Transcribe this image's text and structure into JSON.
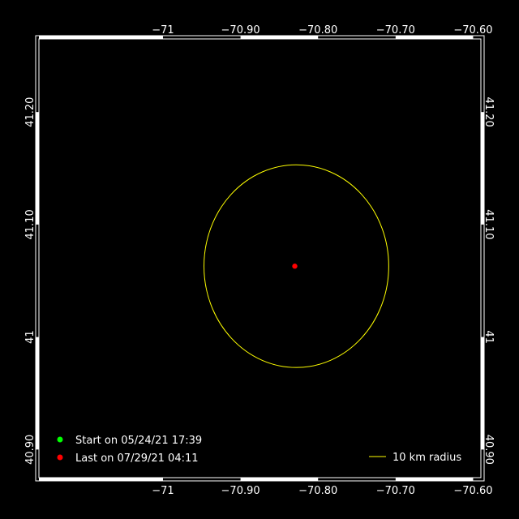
{
  "map": {
    "lon_range": [
      -71.16,
      -70.59
    ],
    "lat_range": [
      40.875,
      41.265
    ],
    "lon_ticks": [
      {
        "value": -71.0,
        "label": "−71"
      },
      {
        "value": -70.9,
        "label": "−70.90"
      },
      {
        "value": -70.8,
        "label": "−70.80"
      },
      {
        "value": -70.7,
        "label": "−70.70"
      },
      {
        "value": -70.6,
        "label": "−70.60"
      }
    ],
    "lat_ticks": [
      {
        "value": 40.9,
        "label": "40.90"
      },
      {
        "value": 41.0,
        "label": "41"
      },
      {
        "value": 41.1,
        "label": "41.10"
      },
      {
        "value": 41.2,
        "label": "41.20"
      }
    ],
    "colors": {
      "background": "#000000",
      "frame": "#ffffff",
      "radius_circle": "#ffff00",
      "start_marker": "#00ff00",
      "last_marker": "#ff0000",
      "text": "#ffffff"
    }
  },
  "track": {
    "center_lon": -70.828,
    "center_lat": 41.063,
    "radius_km": 10,
    "last_point": {
      "lon": -70.83,
      "lat": 41.063
    }
  },
  "legend": {
    "start_label": "Start on 05/24/21 17:39",
    "last_label": "Last on 07/29/21 04:11",
    "radius_label": "10 km radius"
  }
}
